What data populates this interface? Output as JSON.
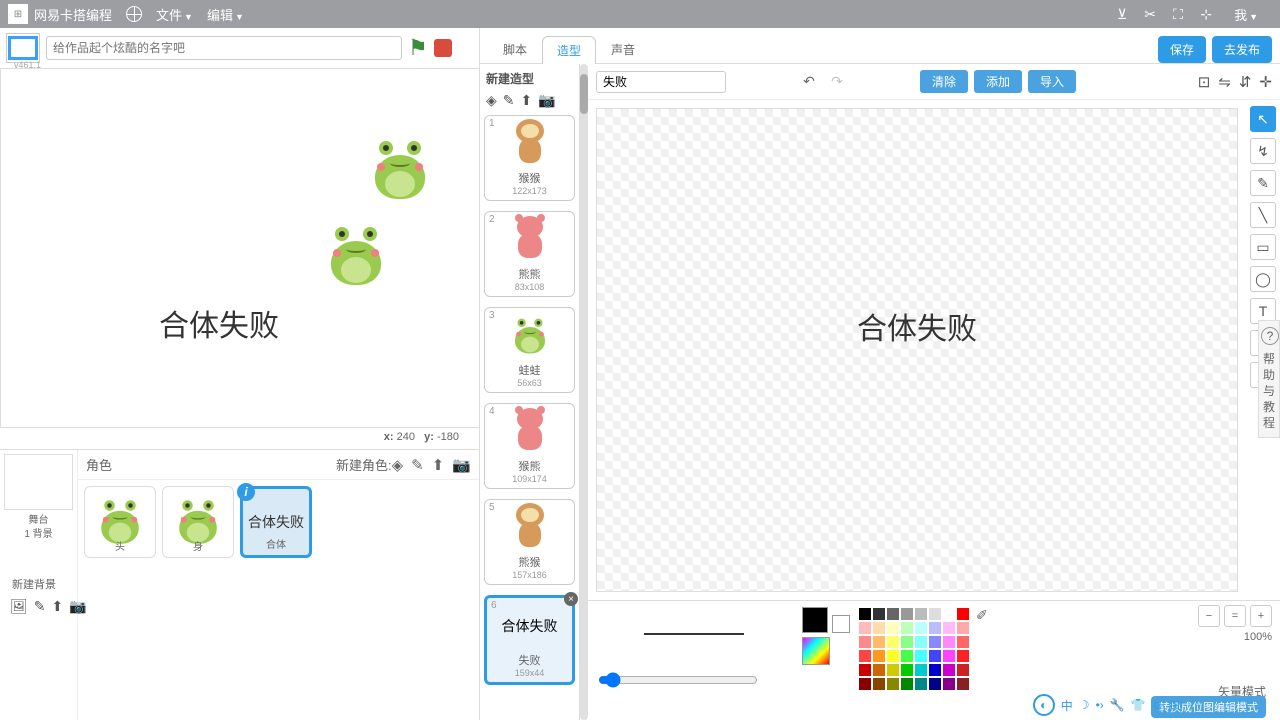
{
  "menu": {
    "title": "网易卡搭编程",
    "file": "文件",
    "edit": "编辑",
    "me": "我"
  },
  "header": {
    "version": "v461.1",
    "name_placeholder": "给作品起个炫酷的名字吧"
  },
  "stage": {
    "text": "合体失败",
    "coords_x_label": "x:",
    "coords_x": "240",
    "coords_y_label": "y:",
    "coords_y": "-180"
  },
  "stage_panel": {
    "label": "舞台",
    "backdrop_count": "1 背景",
    "new_backdrop": "新建背景"
  },
  "sprites": {
    "label": "角色",
    "new_label": "新建角色:",
    "items": [
      {
        "name": "头"
      },
      {
        "name": "身"
      },
      {
        "name": "合体",
        "display": "合体失败"
      }
    ]
  },
  "tabs": {
    "scripts": "脚本",
    "costumes": "造型",
    "sounds": "声音",
    "save": "保存",
    "publish": "去发布"
  },
  "costumes": {
    "new_label": "新建造型",
    "name_value": "失败",
    "clear": "清除",
    "add": "添加",
    "import": "导入",
    "canvas_text": "合体失败",
    "items": [
      {
        "num": "1",
        "name": "猴猴",
        "size": "122x173",
        "type": "monkey"
      },
      {
        "num": "2",
        "name": "熊熊",
        "size": "83x108",
        "type": "bear"
      },
      {
        "num": "3",
        "name": "蛙蛙",
        "size": "56x63",
        "type": "frog"
      },
      {
        "num": "4",
        "name": "猴熊",
        "size": "109x174",
        "type": "bear"
      },
      {
        "num": "5",
        "name": "熊猴",
        "size": "157x186",
        "type": "monkey-orange"
      },
      {
        "num": "6",
        "name": "失败",
        "size": "159x44",
        "type": "text",
        "text": "合体失败"
      }
    ]
  },
  "zoom": {
    "pct": "100%"
  },
  "vector": {
    "label": "矢量模式",
    "convert": "转换成位图编辑模式"
  },
  "help": {
    "q": "?",
    "text": "帮助与教程"
  },
  "ime": {
    "lang": "中"
  }
}
